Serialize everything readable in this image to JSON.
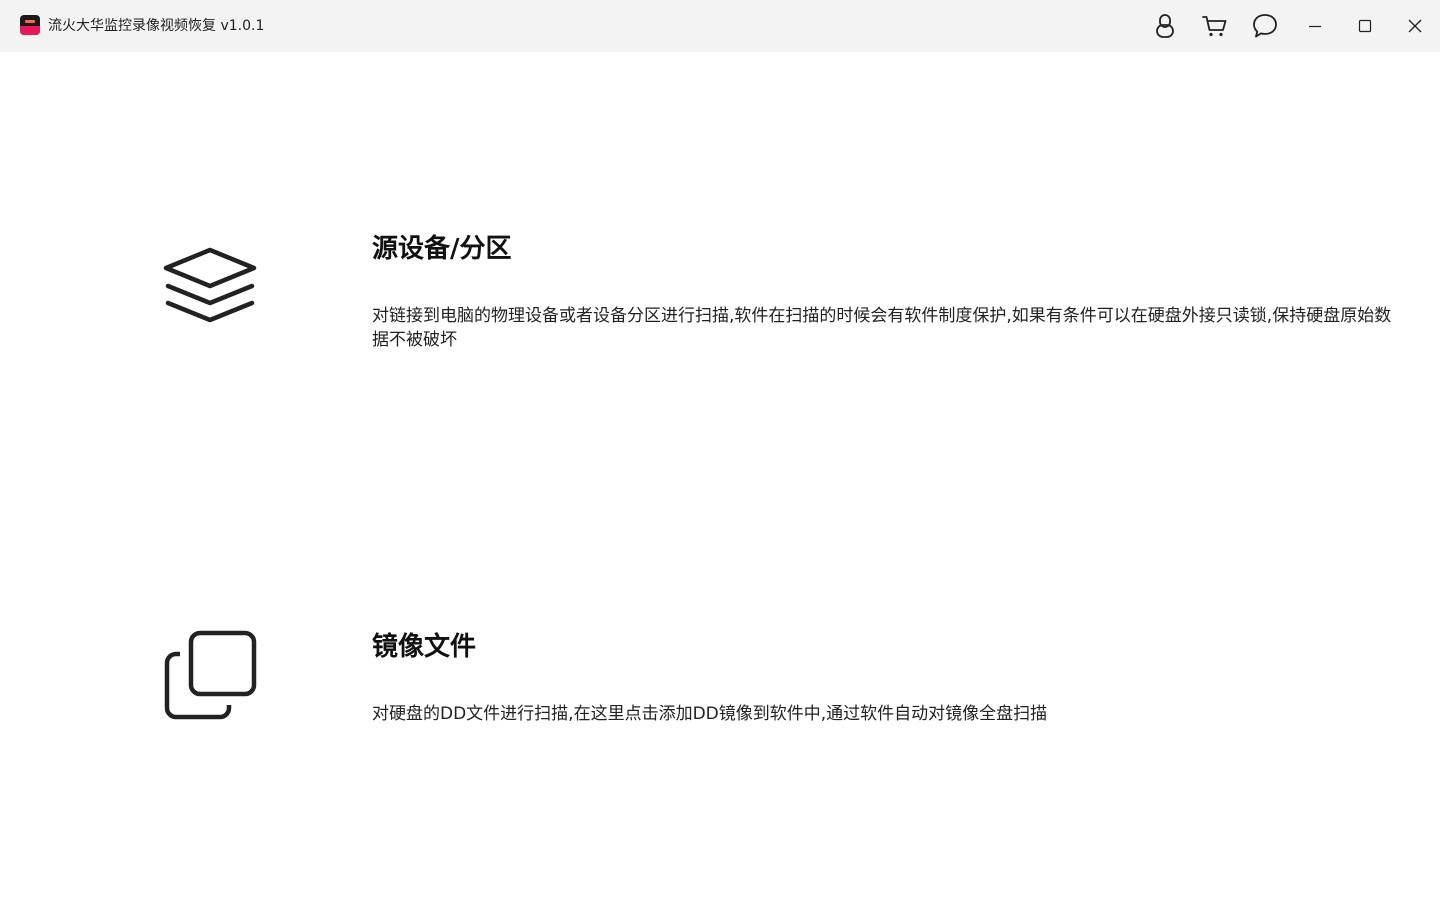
{
  "window": {
    "title": "流火大华监控录像视频恢复 v1.0.1",
    "logo_icon": "app-logo-icon",
    "controls": [
      {
        "name": "account-icon"
      },
      {
        "name": "cart-icon"
      },
      {
        "name": "chat-icon"
      },
      {
        "name": "minimize-icon"
      },
      {
        "name": "maximize-icon"
      },
      {
        "name": "close-icon"
      }
    ]
  },
  "options": [
    {
      "icon": "layers-icon",
      "title": "源设备/分区",
      "description": "对链接到电脑的物理设备或者设备分区进行扫描,软件在扫描的时候会有软件制度保护,如果有条件可以在硬盘外接只读锁,保持硬盘原始数据不被破坏"
    },
    {
      "icon": "copy-image-icon",
      "title": "镜像文件",
      "description": "对硬盘的DD文件进行扫描,在这里点击添加DD镜像到软件中,通过软件自动对镜像全盘扫描"
    }
  ],
  "colors": {
    "titlebar_bg": "#f3f3f3",
    "logo_accent": "#e8185c",
    "text": "#1a1a1a"
  }
}
